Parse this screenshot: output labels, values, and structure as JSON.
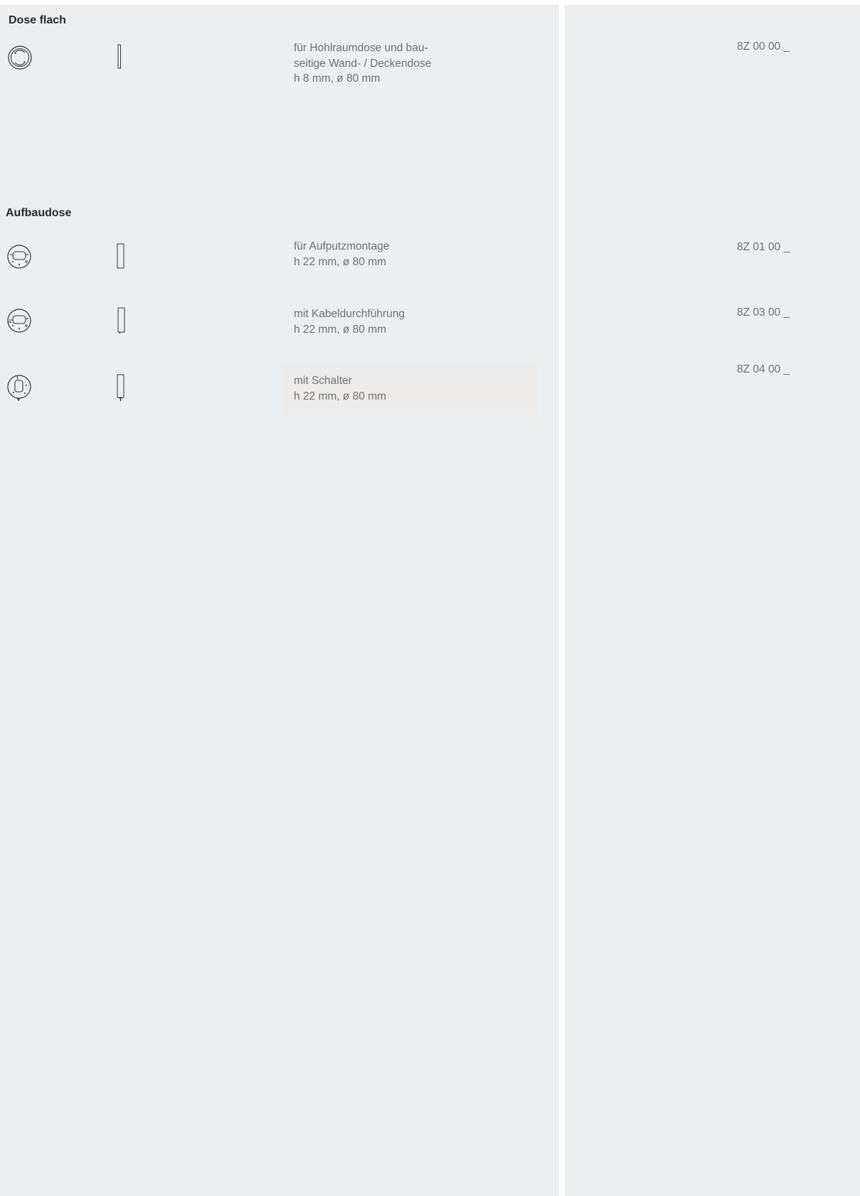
{
  "sections": [
    {
      "heading": "Dose flach",
      "items": [
        {
          "description": [
            "für Hohlraumdose und bau-",
            "seitige Wand- / Deckendose",
            "h  8 mm,  ø  80 mm"
          ],
          "article": "8Z 00 00 _",
          "top_icon": "flush-box-top-view-icon",
          "side_icon": "flush-box-side-view-icon"
        }
      ]
    },
    {
      "heading": "Aufbaudose",
      "items": [
        {
          "description": [
            "für Aufputzmontage",
            "h  22 mm,  ø  80 mm"
          ],
          "article": "8Z 01 00 _",
          "top_icon": "surface-box-top-view-icon",
          "side_icon": "surface-box-side-view-icon"
        },
        {
          "description": [
            "mit Kabeldurchführung",
            "h  22 mm,  ø  80 mm"
          ],
          "article": "8Z 03 00 _",
          "top_icon": "cable-entry-box-top-view-icon",
          "side_icon": "cable-entry-box-side-view-icon"
        },
        {
          "description": [
            "mit Schalter",
            "h  22 mm,  ø  80 mm"
          ],
          "article": "8Z 04 00 _",
          "top_icon": "switch-box-top-view-icon",
          "side_icon": "switch-box-side-view-icon"
        }
      ]
    }
  ]
}
